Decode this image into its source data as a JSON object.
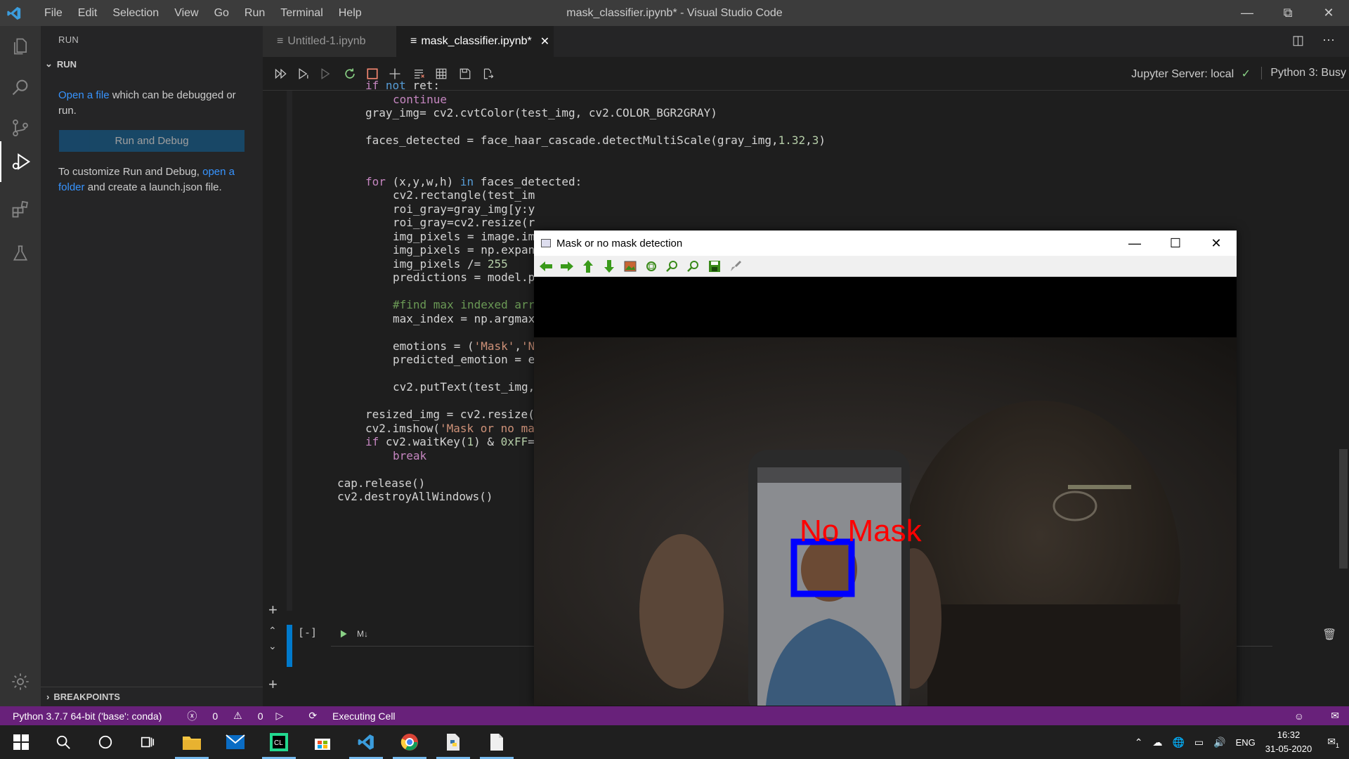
{
  "window": {
    "title": "mask_classifier.ipynb* - Visual Studio Code",
    "menu": [
      "File",
      "Edit",
      "Selection",
      "View",
      "Go",
      "Run",
      "Terminal",
      "Help"
    ]
  },
  "sidebar": {
    "header": "RUN",
    "section": "RUN",
    "open_file_link": "Open a file",
    "open_file_rest": " which can be debugged or run.",
    "run_debug_button": "Run and Debug",
    "customize_text": "To customize Run and Debug, ",
    "open_folder_link": "open a folder",
    "customize_rest": " and create a launch.json file.",
    "breakpoints": "BREAKPOINTS"
  },
  "tabs": [
    {
      "label": "Untitled-1.ipynb",
      "active": false
    },
    {
      "label": "mask_classifier.ipynb*",
      "active": true
    }
  ],
  "notebook_toolbar": {
    "server": "Jupyter Server: local",
    "kernel": "Python 3: Busy"
  },
  "code": {
    "lines": [
      {
        "indent": 1,
        "tokens": [
          {
            "t": "if ",
            "c": "kwc"
          },
          {
            "t": "not ",
            "c": "kw"
          },
          {
            "t": "ret:",
            "c": ""
          }
        ]
      },
      {
        "indent": 2,
        "tokens": [
          {
            "t": "continue",
            "c": "kwc"
          }
        ]
      },
      {
        "indent": 1,
        "tokens": [
          {
            "t": "gray_img= cv2.cvtColor(test_img, cv2.COLOR_BGR2GRAY)",
            "c": ""
          }
        ]
      },
      {
        "indent": 0,
        "tokens": []
      },
      {
        "indent": 1,
        "tokens": [
          {
            "t": "faces_detected = face_haar_cascade.detectMultiScale(gray_img,",
            "c": ""
          },
          {
            "t": "1.32",
            "c": "num"
          },
          {
            "t": ",",
            "c": ""
          },
          {
            "t": "3",
            "c": "num"
          },
          {
            "t": ")",
            "c": ""
          }
        ]
      },
      {
        "indent": 0,
        "tokens": []
      },
      {
        "indent": 0,
        "tokens": []
      },
      {
        "indent": 1,
        "tokens": [
          {
            "t": "for ",
            "c": "kwc"
          },
          {
            "t": "(x,y,w,h) ",
            "c": ""
          },
          {
            "t": "in ",
            "c": "kw"
          },
          {
            "t": "faces_detected:",
            "c": ""
          }
        ]
      },
      {
        "indent": 2,
        "tokens": [
          {
            "t": "cv2.rectangle(test_im",
            "c": ""
          }
        ]
      },
      {
        "indent": 2,
        "tokens": [
          {
            "t": "roi_gray=gray_img[y:y",
            "c": ""
          }
        ]
      },
      {
        "indent": 2,
        "tokens": [
          {
            "t": "roi_gray=cv2.resize(r",
            "c": ""
          }
        ]
      },
      {
        "indent": 2,
        "tokens": [
          {
            "t": "img_pixels = image.im",
            "c": ""
          }
        ]
      },
      {
        "indent": 2,
        "tokens": [
          {
            "t": "img_pixels = np.expan",
            "c": ""
          }
        ]
      },
      {
        "indent": 2,
        "tokens": [
          {
            "t": "img_pixels /= ",
            "c": ""
          },
          {
            "t": "255",
            "c": "num"
          }
        ]
      },
      {
        "indent": 2,
        "tokens": [
          {
            "t": "predictions = model.p",
            "c": ""
          }
        ]
      },
      {
        "indent": 0,
        "tokens": []
      },
      {
        "indent": 2,
        "tokens": [
          {
            "t": "#find max indexed arr",
            "c": "cm"
          }
        ]
      },
      {
        "indent": 2,
        "tokens": [
          {
            "t": "max_index = np.argmax",
            "c": ""
          }
        ]
      },
      {
        "indent": 0,
        "tokens": []
      },
      {
        "indent": 2,
        "tokens": [
          {
            "t": "emotions = (",
            "c": ""
          },
          {
            "t": "'Mask'",
            "c": "str"
          },
          {
            "t": ",",
            "c": ""
          },
          {
            "t": "'N",
            "c": "str"
          }
        ]
      },
      {
        "indent": 2,
        "tokens": [
          {
            "t": "predicted_emotion = e",
            "c": ""
          }
        ]
      },
      {
        "indent": 0,
        "tokens": []
      },
      {
        "indent": 2,
        "tokens": [
          {
            "t": "cv2.putText(test_img,",
            "c": ""
          }
        ]
      },
      {
        "indent": 0,
        "tokens": []
      },
      {
        "indent": 1,
        "tokens": [
          {
            "t": "resized_img = cv2.resize(",
            "c": ""
          }
        ]
      },
      {
        "indent": 1,
        "tokens": [
          {
            "t": "cv2.imshow(",
            "c": ""
          },
          {
            "t": "'Mask or no ma",
            "c": "str"
          }
        ]
      },
      {
        "indent": 1,
        "tokens": [
          {
            "t": "if ",
            "c": "kwc"
          },
          {
            "t": "cv2.waitKey(",
            "c": ""
          },
          {
            "t": "1",
            "c": "num"
          },
          {
            "t": ") & ",
            "c": ""
          },
          {
            "t": "0xFF",
            "c": "num"
          },
          {
            "t": "=",
            "c": ""
          }
        ]
      },
      {
        "indent": 2,
        "tokens": [
          {
            "t": "break",
            "c": "kwc"
          }
        ]
      },
      {
        "indent": 0,
        "tokens": []
      },
      {
        "indent": 0,
        "tokens": [
          {
            "t": "cap.release()",
            "c": ""
          }
        ]
      },
      {
        "indent": 0,
        "tokens": [
          {
            "t": "cv2.destroyAllWindows()",
            "c": ""
          }
        ]
      }
    ],
    "next_cell_prompt": "[-]",
    "next_cell_type": "M↓"
  },
  "statusbar": {
    "interpreter": "Python 3.7.7 64-bit ('base': conda)",
    "errors": "0",
    "warnings": "0",
    "executing": "Executing Cell"
  },
  "taskbar": {
    "lang": "ENG",
    "time": "16:32",
    "date": "31-05-2020",
    "notifications": "1"
  },
  "popup": {
    "title": "Mask or no mask detection",
    "label": "No Mask"
  },
  "colors": {
    "statusbar": "#68217a",
    "accent": "#0e639c",
    "detection_box": "#0000ff",
    "detection_label": "#ff0000"
  }
}
